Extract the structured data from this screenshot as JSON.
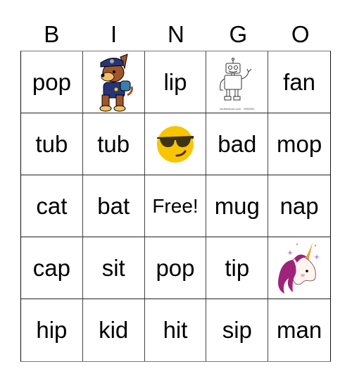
{
  "header": [
    "B",
    "I",
    "N",
    "G",
    "O"
  ],
  "cells": [
    [
      {
        "type": "text",
        "text": "pop"
      },
      {
        "type": "image",
        "icon": "police-dog-icon"
      },
      {
        "type": "text",
        "text": "lip"
      },
      {
        "type": "image",
        "icon": "robot-icon",
        "caption": "shutterstock.com · 1960302"
      },
      {
        "type": "text",
        "text": "fan"
      }
    ],
    [
      {
        "type": "text",
        "text": "tub"
      },
      {
        "type": "text",
        "text": "tub"
      },
      {
        "type": "image",
        "icon": "sunglasses-emoji-icon"
      },
      {
        "type": "text",
        "text": "bad"
      },
      {
        "type": "text",
        "text": "mop"
      }
    ],
    [
      {
        "type": "text",
        "text": "cat"
      },
      {
        "type": "text",
        "text": "bat"
      },
      {
        "type": "free",
        "text": "Free!"
      },
      {
        "type": "text",
        "text": "mug"
      },
      {
        "type": "text",
        "text": "nap"
      }
    ],
    [
      {
        "type": "text",
        "text": "cap"
      },
      {
        "type": "text",
        "text": "sit"
      },
      {
        "type": "text",
        "text": "pop"
      },
      {
        "type": "text",
        "text": "tip"
      },
      {
        "type": "image",
        "icon": "unicorn-icon"
      }
    ],
    [
      {
        "type": "text",
        "text": "hip"
      },
      {
        "type": "text",
        "text": "kid"
      },
      {
        "type": "text",
        "text": "hit"
      },
      {
        "type": "text",
        "text": "sip"
      },
      {
        "type": "text",
        "text": "man"
      }
    ]
  ],
  "colors": {
    "emoji_yellow": "#F7C600",
    "dog_blue": "#26357A",
    "dog_brown": "#A0562A",
    "unicorn_pink": "#A0237A",
    "horn_gold": "#E6A62A"
  }
}
